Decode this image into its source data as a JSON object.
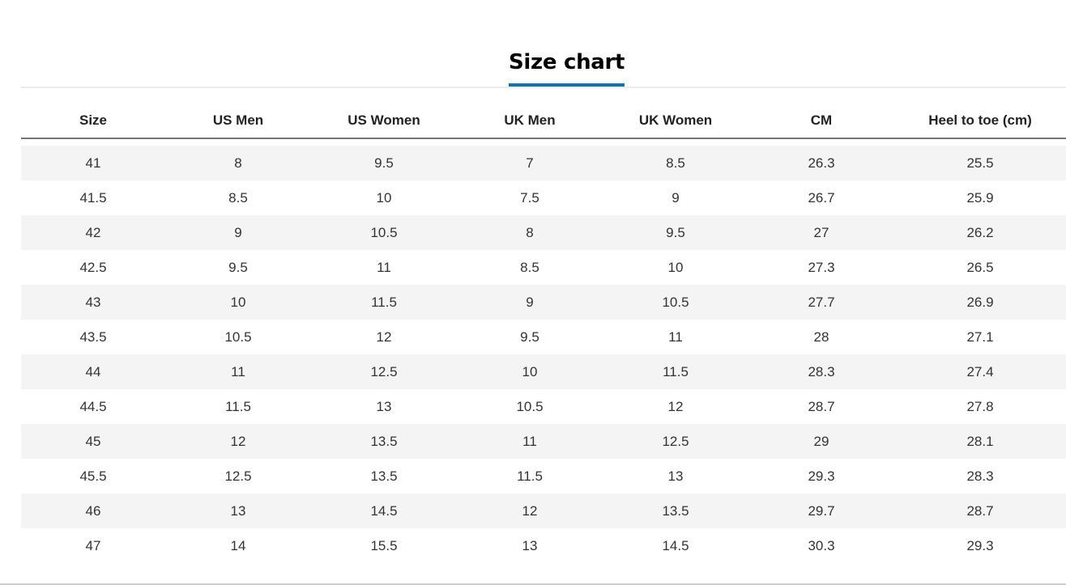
{
  "title": "Size chart",
  "colors": {
    "accent": "#1273b3",
    "row_stripe": "#f4f4f4",
    "header_rule": "#757575"
  },
  "table": {
    "columns": [
      "Size",
      "US Men",
      "US Women",
      "UK Men",
      "UK Women",
      "CM",
      "Heel to toe (cm)"
    ],
    "rows": [
      [
        "41",
        "8",
        "9.5",
        "7",
        "8.5",
        "26.3",
        "25.5"
      ],
      [
        "41.5",
        "8.5",
        "10",
        "7.5",
        "9",
        "26.7",
        "25.9"
      ],
      [
        "42",
        "9",
        "10.5",
        "8",
        "9.5",
        "27",
        "26.2"
      ],
      [
        "42.5",
        "9.5",
        "11",
        "8.5",
        "10",
        "27.3",
        "26.5"
      ],
      [
        "43",
        "10",
        "11.5",
        "9",
        "10.5",
        "27.7",
        "26.9"
      ],
      [
        "43.5",
        "10.5",
        "12",
        "9.5",
        "11",
        "28",
        "27.1"
      ],
      [
        "44",
        "11",
        "12.5",
        "10",
        "11.5",
        "28.3",
        "27.4"
      ],
      [
        "44.5",
        "11.5",
        "13",
        "10.5",
        "12",
        "28.7",
        "27.8"
      ],
      [
        "45",
        "12",
        "13.5",
        "11",
        "12.5",
        "29",
        "28.1"
      ],
      [
        "45.5",
        "12.5",
        "13.5",
        "11.5",
        "13",
        "29.3",
        "28.3"
      ],
      [
        "46",
        "13",
        "14.5",
        "12",
        "13.5",
        "29.7",
        "28.7"
      ],
      [
        "47",
        "14",
        "15.5",
        "13",
        "14.5",
        "30.3",
        "29.3"
      ]
    ]
  }
}
